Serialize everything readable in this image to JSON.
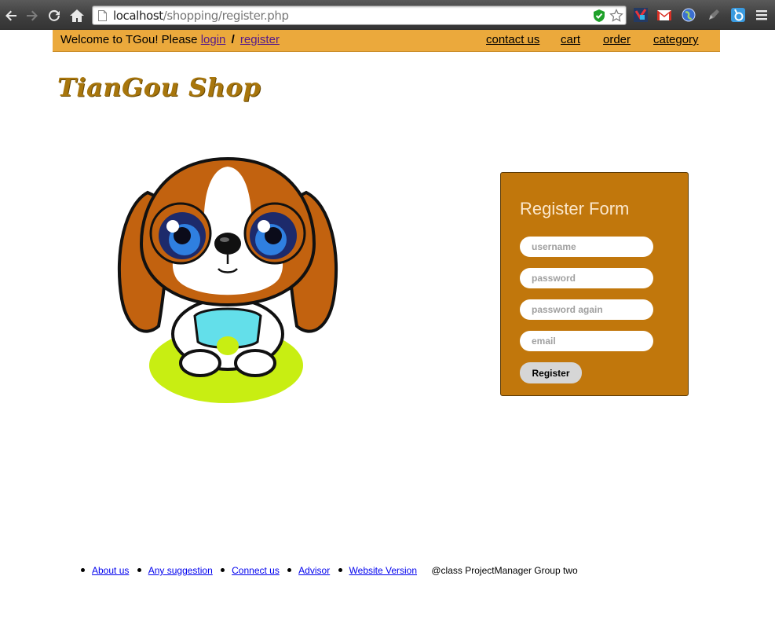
{
  "browser": {
    "url_host": "localhost",
    "url_path": "/shopping/register.php",
    "icons": [
      "back-icon",
      "forward-icon",
      "reload-icon",
      "home-icon",
      "page-icon",
      "shield-check-icon",
      "star-icon",
      "puzzle-extension-icon",
      "gmail-icon",
      "globe-icon",
      "pen-extension-icon",
      "badge-extension-icon",
      "menu-icon"
    ]
  },
  "header": {
    "welcome_text": "Welcome to TGou! Please",
    "login_label": "login",
    "separator": "/",
    "register_label": "register",
    "nav": [
      "contact us",
      "cart",
      "order",
      "category"
    ],
    "bar_color": "#eba93c"
  },
  "logo": {
    "text": "TianGou Shop",
    "color": "#a8760c"
  },
  "mascot": {
    "icon": "puppy-mascot-illustration"
  },
  "register_form": {
    "title": "Register Form",
    "username_placeholder": "username",
    "password_placeholder": "password",
    "password_again_placeholder": "password again",
    "email_placeholder": "email",
    "button_label": "Register",
    "panel_color": "#c1770c"
  },
  "footer": {
    "links": [
      "About us",
      "Any suggestion",
      "Connect us",
      "Advisor",
      "Website Version"
    ],
    "credit": "@class ProjectManager Group two"
  }
}
